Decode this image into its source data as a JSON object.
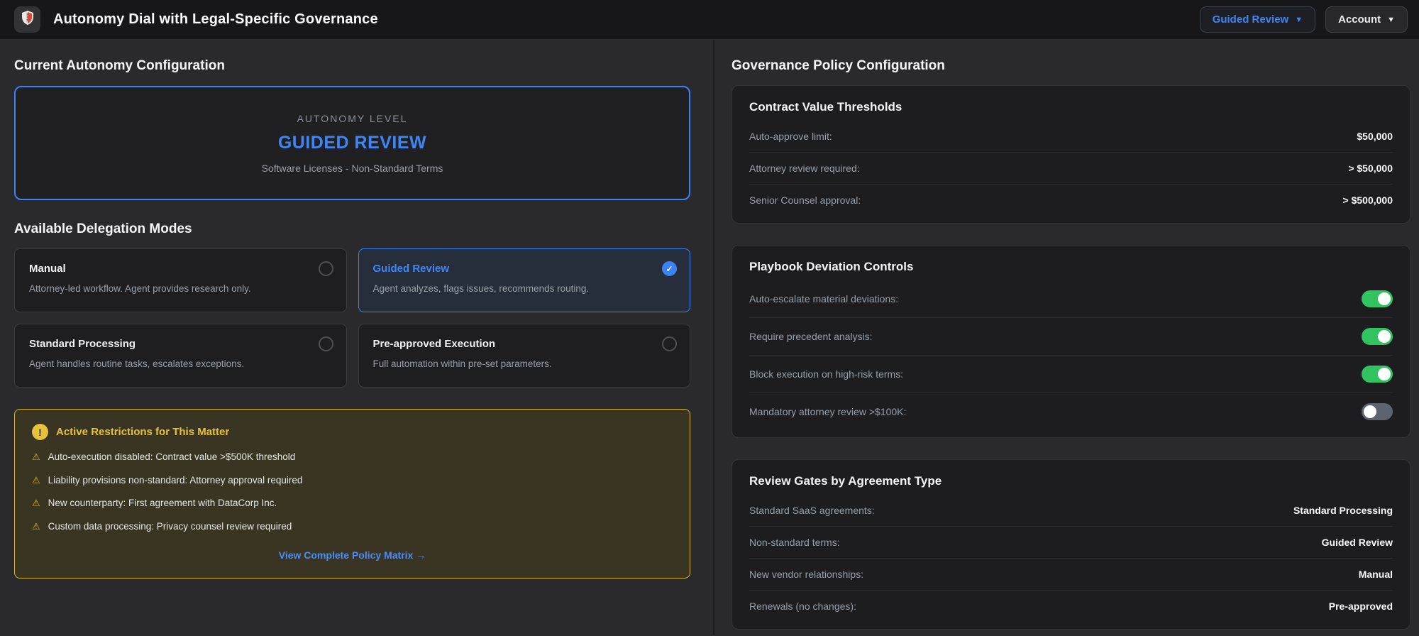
{
  "header": {
    "title": "Autonomy Dial with Legal-Specific Governance",
    "mode_button": {
      "label": "Guided Review"
    },
    "account_button": {
      "label": "Account"
    }
  },
  "icons": {
    "caret_down": "▼",
    "check": "✓",
    "alert": "!",
    "warning": "⚠"
  },
  "colors": {
    "accent_blue": "#3b82f6",
    "warning_yellow": "#d8b62e",
    "toggle_on_green": "#31c35f",
    "toggle_off_gray": "#5d6470"
  },
  "left_panel": {
    "section_title": "Current Autonomy Configuration",
    "autonomy_display": {
      "eyebrow": "AUTONOMY LEVEL",
      "level": "GUIDED REVIEW",
      "matter": "Software Licenses - Non-Standard Terms"
    },
    "modes_title": "Available Delegation Modes",
    "modes": [
      {
        "name": "Manual",
        "description": "Attorney-led workflow. Agent provides research only.",
        "selected": false
      },
      {
        "name": "Guided Review",
        "description": "Agent analyzes, flags issues, recommends routing.",
        "selected": true
      },
      {
        "name": "Standard Processing",
        "description": "Agent handles routine tasks, escalates exceptions.",
        "selected": false
      },
      {
        "name": "Pre-approved Execution",
        "description": "Full automation within pre-set parameters.",
        "selected": false
      }
    ],
    "restrictions": {
      "title": "Active Restrictions for This Matter",
      "items": [
        "Auto-execution disabled: Contract value >$500K threshold",
        "Liability provisions non-standard: Attorney approval required",
        "New counterparty: First agreement with DataCorp Inc.",
        "Custom data processing: Privacy counsel review required"
      ],
      "link_label": "View Complete Policy Matrix →"
    }
  },
  "right_panel": {
    "section_title": "Governance Policy Configuration",
    "cards": [
      {
        "title": "Contract Value Thresholds",
        "rows": [
          {
            "label": "Auto-approve limit:",
            "value": "$50,000"
          },
          {
            "label": "Attorney review required:",
            "value": "> $50,000"
          },
          {
            "label": "Senior Counsel approval:",
            "value": "> $500,000"
          }
        ]
      },
      {
        "title": "Playbook Deviation Controls",
        "toggles": [
          {
            "label": "Auto-escalate material deviations:",
            "on": true
          },
          {
            "label": "Require precedent analysis:",
            "on": true
          },
          {
            "label": "Block execution on high-risk terms:",
            "on": true
          },
          {
            "label": "Mandatory attorney review >$100K:",
            "on": false
          }
        ]
      },
      {
        "title": "Review Gates by Agreement Type",
        "rows": [
          {
            "label": "Standard SaaS agreements:",
            "value": "Standard Processing"
          },
          {
            "label": "Non-standard terms:",
            "value": "Guided Review"
          },
          {
            "label": "New vendor relationships:",
            "value": "Manual"
          },
          {
            "label": "Renewals (no changes):",
            "value": "Pre-approved"
          }
        ]
      }
    ]
  }
}
